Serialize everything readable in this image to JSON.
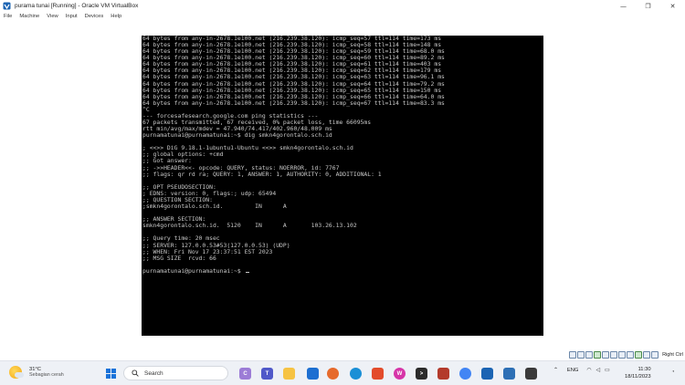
{
  "window": {
    "title": "purama tunai [Running] - Oracle VM VirtualBox",
    "controls": {
      "minimize": "—",
      "restore": "❐",
      "close": "✕"
    }
  },
  "menu": [
    "File",
    "Machine",
    "View",
    "Input",
    "Devices",
    "Help"
  ],
  "terminal": {
    "lines": [
      "64 bytes from any-in-2678.1e100.net (216.239.38.120): icmp_seq=57 ttl=114 time=173 ms",
      "64 bytes from any-in-2678.1e100.net (216.239.38.120): icmp_seq=58 ttl=114 time=148 ms",
      "64 bytes from any-in-2678.1e100.net (216.239.38.120): icmp_seq=59 ttl=114 time=68.0 ms",
      "64 bytes from any-in-2678.1e100.net (216.239.38.120): icmp_seq=60 ttl=114 time=89.2 ms",
      "64 bytes from any-in-2678.1e100.net (216.239.38.120): icmp_seq=61 ttl=114 time=403 ms",
      "64 bytes from any-in-2678.1e100.net (216.239.38.120): icmp_seq=62 ttl=114 time=179 ms",
      "64 bytes from any-in-2678.1e100.net (216.239.38.120): icmp_seq=63 ttl=114 time=96.1 ms",
      "64 bytes from any-in-2678.1e100.net (216.239.38.120): icmp_seq=64 ttl=114 time=79.2 ms",
      "64 bytes from any-in-2678.1e100.net (216.239.38.120): icmp_seq=65 ttl=114 time=150 ms",
      "64 bytes from any-in-2678.1e100.net (216.239.38.120): icmp_seq=66 ttl=114 time=64.0 ms",
      "64 bytes from any-in-2678.1e100.net (216.239.38.120): icmp_seq=67 ttl=114 time=83.3 ms",
      "^C",
      "--- forcesafesearch.google.com ping statistics ---",
      "67 packets transmitted, 67 received, 0% packet loss, time 66095ms",
      "rtt min/avg/max/mdev = 47.940/74.417/402.960/48.009 ms",
      "purnamatunai@purnamatunai:~$ dig smkn4gorontalo.sch.id",
      "",
      "; <<>> DiG 9.18.1-1ubuntu1-Ubuntu <<>> smkn4gorontalo.sch.id",
      ";; global options: +cmd",
      ";; Got answer:",
      ";; ->>HEADER<<- opcode: QUERY, status: NOERROR, id: 7767",
      ";; flags: qr rd ra; QUERY: 1, ANSWER: 1, AUTHORITY: 0, ADDITIONAL: 1",
      "",
      ";; OPT PSEUDOSECTION:",
      "; EDNS: version: 0, flags:; udp: 65494",
      ";; QUESTION SECTION:",
      ";smkn4gorontalo.sch.id.         IN      A",
      "",
      ";; ANSWER SECTION:",
      "smkn4gorontalo.sch.id.  5120    IN      A       103.26.13.102",
      "",
      ";; Query time: 20 msec",
      ";; SERVER: 127.0.0.53#53(127.0.0.53) (UDP)",
      ";; WHEN: Fri Nov 17 23:37:51 EST 2023",
      ";; MSG SIZE  rcvd: 66",
      "",
      "purnamatunai@purnamatunai:~$ "
    ]
  },
  "status_bar": {
    "host_key": "Right Ctrl"
  },
  "taskbar": {
    "weather_temp": "31°C",
    "weather_desc": "Sebagian cerah",
    "search_label": "Search",
    "language": "ENG",
    "time": "11:30",
    "date": "18/11/2023"
  }
}
